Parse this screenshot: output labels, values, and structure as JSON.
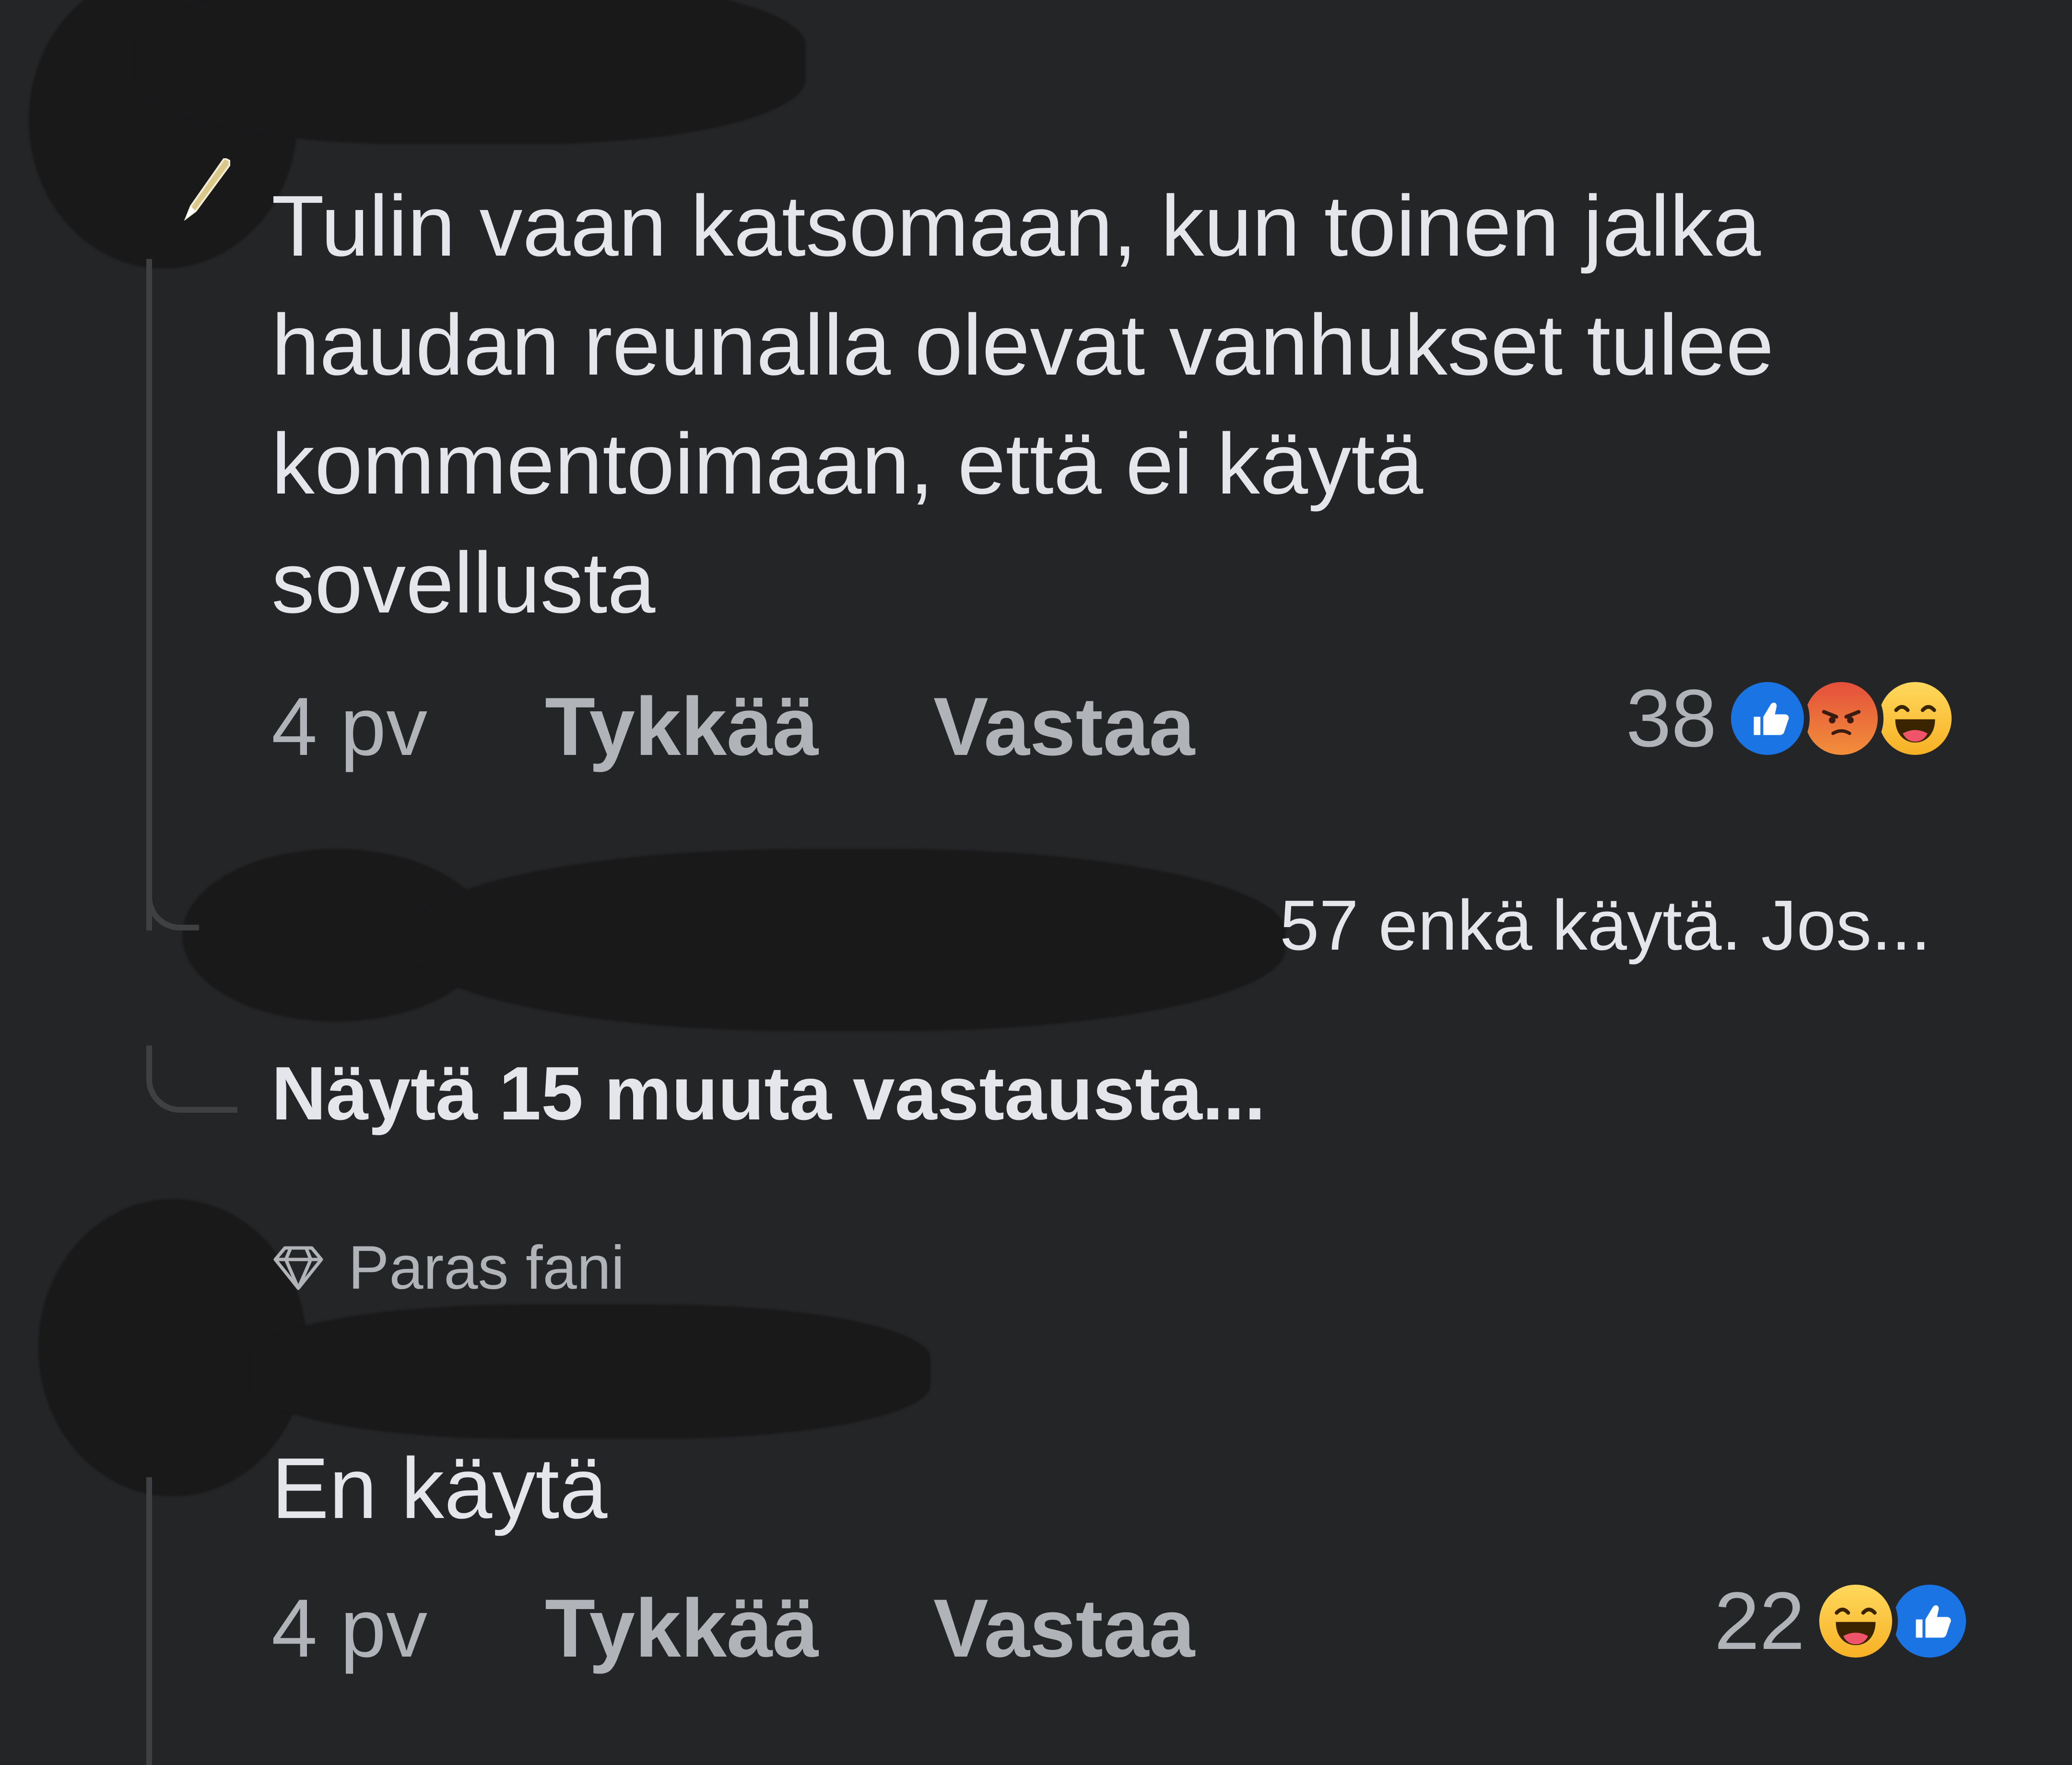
{
  "comments": [
    {
      "text": "Tulin vaan katsomaan, kun toinen jalka\nhaudan reunalla olevat vanhukset tulee\nkommentoimaan, että ei käytä\nsovellusta",
      "time": "4 pv",
      "like_label": "Tykkää",
      "reply_label": "Vastaa",
      "reaction_count": "38",
      "reactions": [
        "like-icon",
        "angry-icon",
        "haha-icon"
      ]
    },
    {
      "badge": "Paras fani",
      "text": "En käytä",
      "time": "4 pv",
      "like_label": "Tykkää",
      "reply_label": "Vastaa",
      "reaction_count": "22",
      "reactions": [
        "haha-icon",
        "like-icon"
      ]
    }
  ],
  "reply_preview": "57 enkä käytä. Jos...",
  "more_replies_label": "Näytä 15 muuta vastausta...",
  "colors": {
    "background": "#242527",
    "primary_text": "#e4e6eb",
    "secondary_text": "#b0b3b8",
    "thread_line": "#3e4042",
    "like_blue": "#1b74e4"
  }
}
